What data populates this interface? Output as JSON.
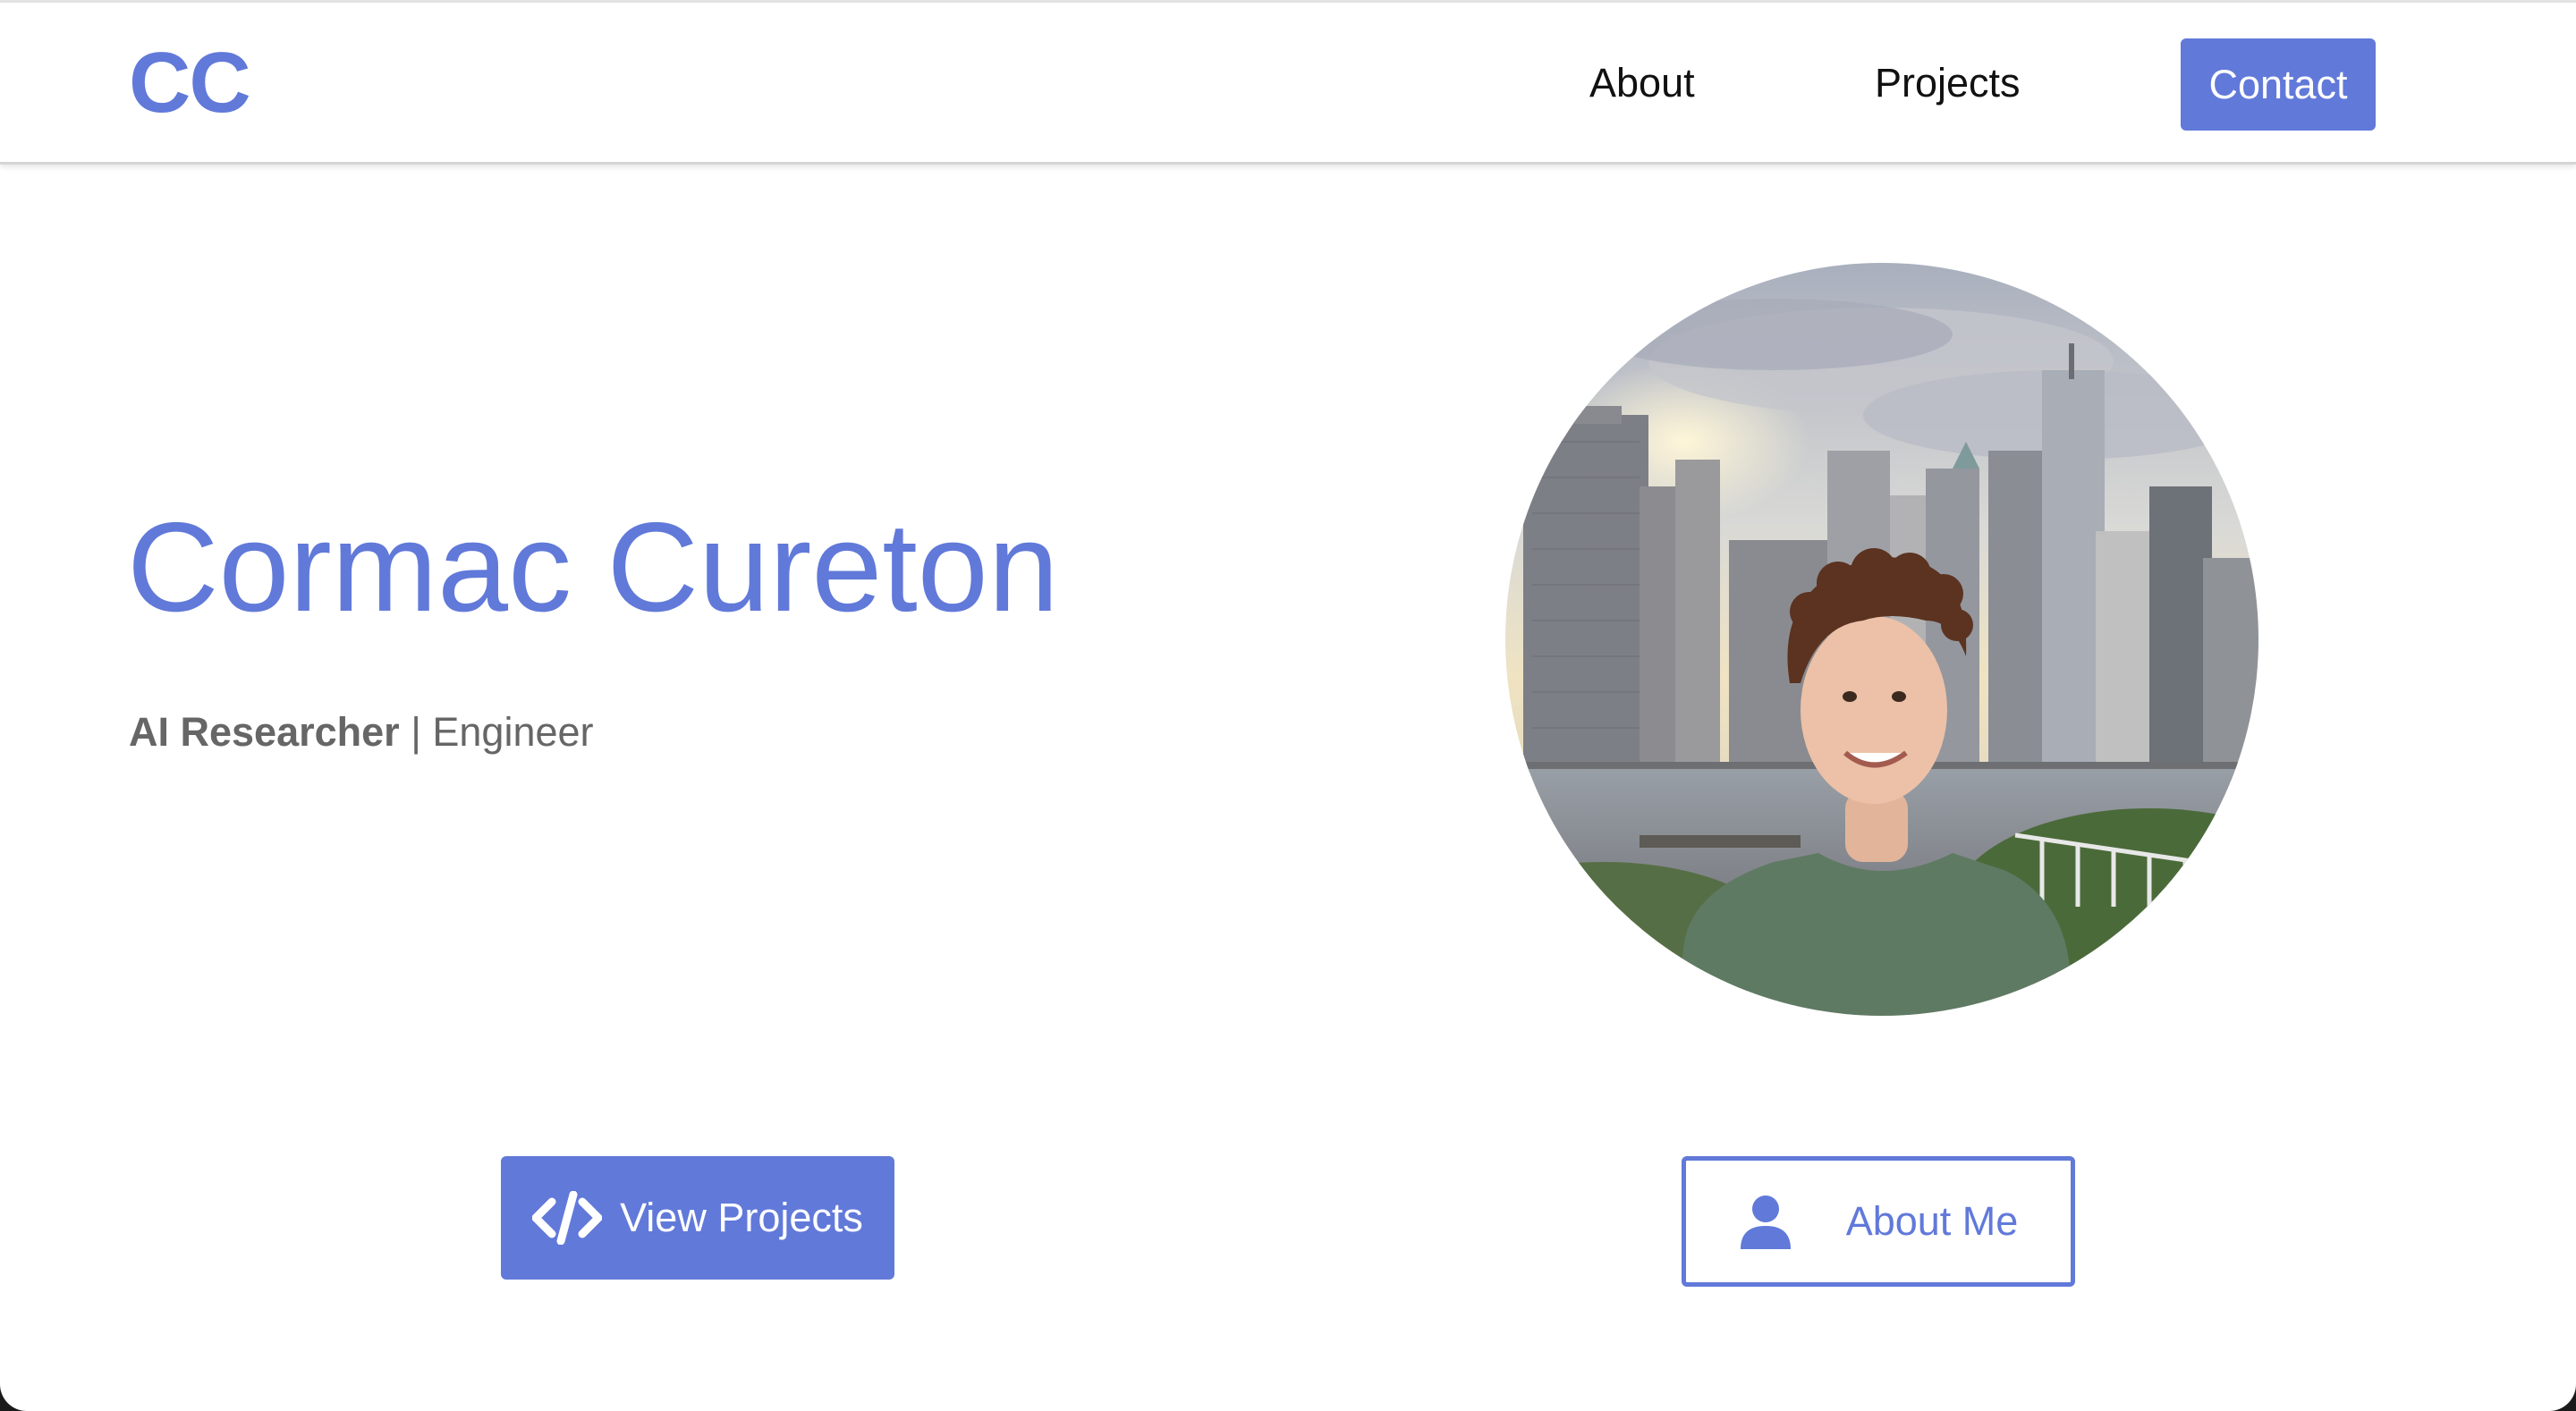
{
  "header": {
    "logo": "CC",
    "nav": {
      "about": "About",
      "projects": "Projects",
      "contact": "Contact"
    }
  },
  "hero": {
    "name": "Cormac Cureton",
    "role": "AI Researcher",
    "separator": " | ",
    "subrole": "Engineer"
  },
  "portrait": {
    "alt": "Cormac Cureton"
  },
  "actions": {
    "view_projects": "View Projects",
    "about_me": "About Me"
  },
  "icons": {
    "view_projects": "code-icon",
    "about_me": "user-icon"
  },
  "colors": {
    "accent": "#6179d9",
    "text_dark": "#111111",
    "text_muted": "#666666",
    "background": "#ffffff"
  }
}
